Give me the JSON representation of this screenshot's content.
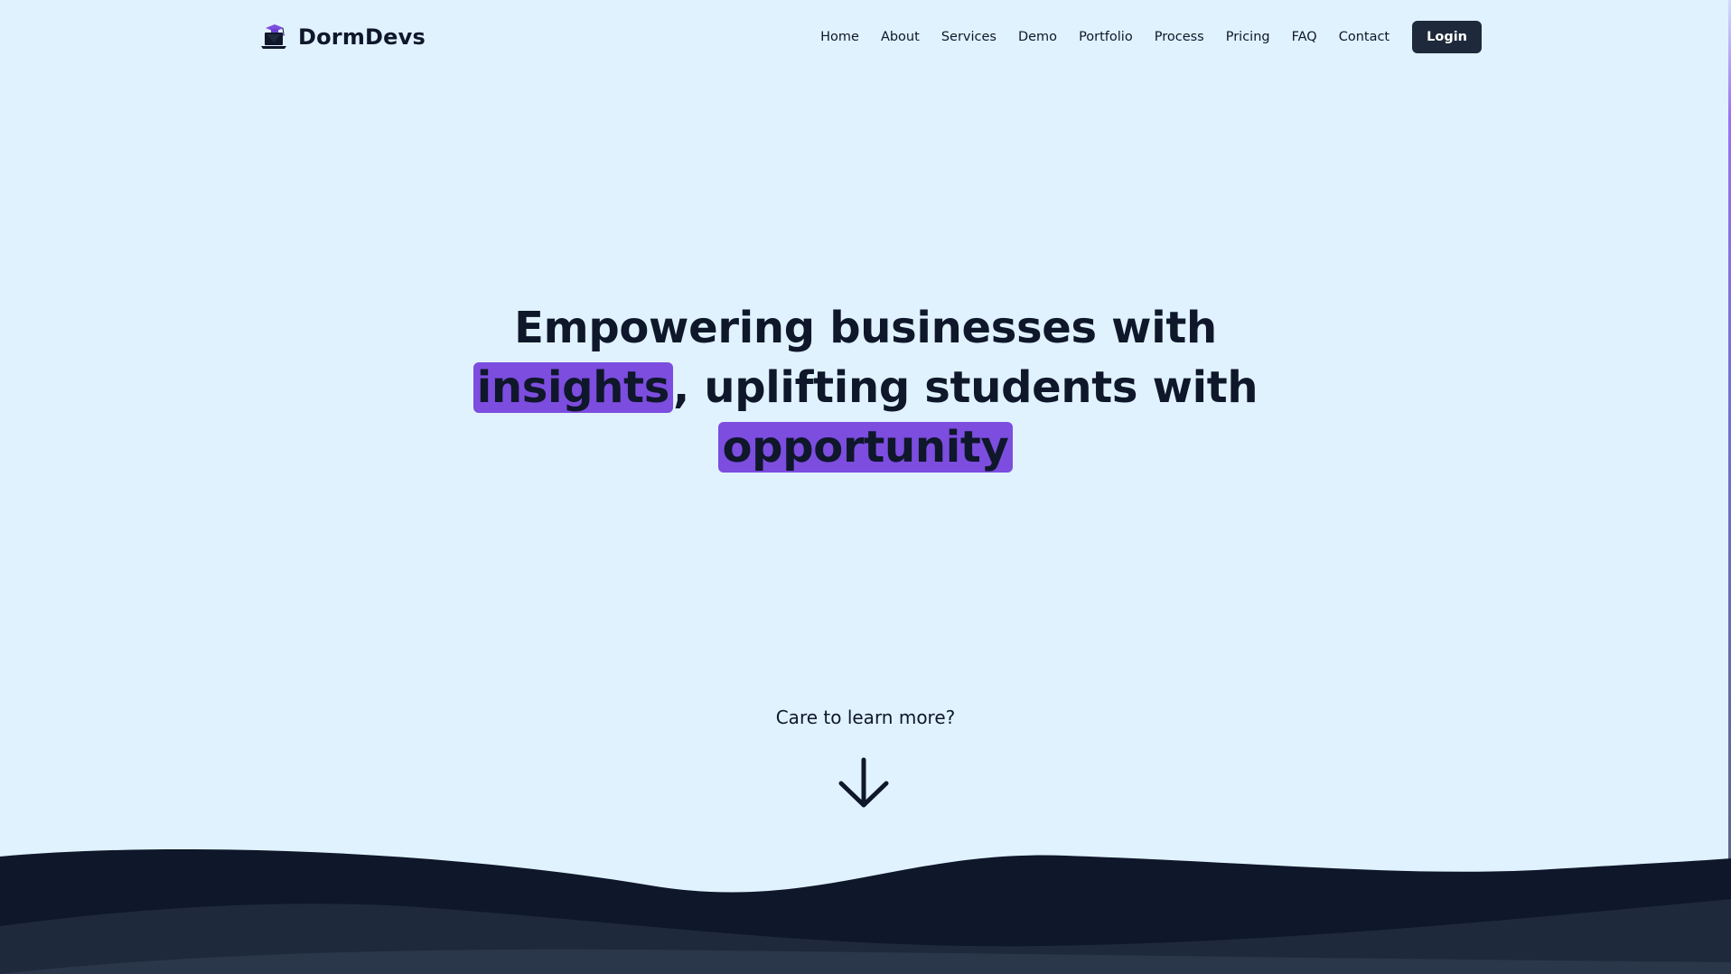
{
  "brand": {
    "name": "DormDevs",
    "logo_icon": "laptop-graduation-cap-icon"
  },
  "nav": {
    "links": [
      {
        "label": "Home"
      },
      {
        "label": "About"
      },
      {
        "label": "Services"
      },
      {
        "label": "Demo"
      },
      {
        "label": "Portfolio"
      },
      {
        "label": "Process"
      },
      {
        "label": "Pricing"
      },
      {
        "label": "FAQ"
      },
      {
        "label": "Contact"
      }
    ],
    "login_label": "Login"
  },
  "hero": {
    "line1": "Empowering businesses with",
    "highlight1": "insights",
    "line2_rest": ", uplifting students with",
    "highlight2": "opportunity",
    "cta_text": "Care to learn more?",
    "cta_icon": "arrow-down-icon"
  },
  "colors": {
    "background": "#e0f2fe",
    "text": "#0f172a",
    "accent_highlight": "#7c4ddf",
    "button": "#1e293b",
    "wave_dark": "#0f172a",
    "wave_mid": "#1e293b",
    "wave_light": "#2a3649"
  }
}
